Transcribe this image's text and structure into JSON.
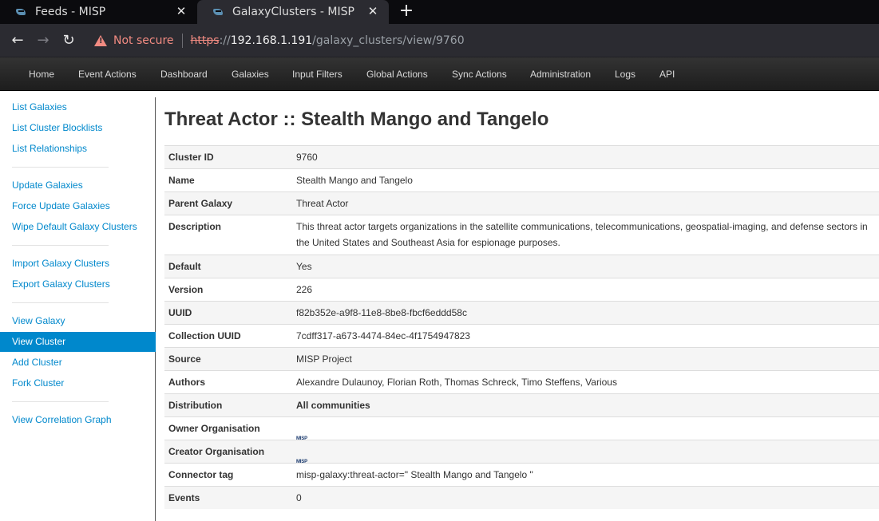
{
  "browser": {
    "tabs": [
      {
        "title": "Feeds - MISP",
        "active": false
      },
      {
        "title": "GalaxyClusters - MISP",
        "active": true
      }
    ],
    "new_tab_icon": "plus-icon",
    "security_label": "Not secure",
    "url": {
      "scheme": "https",
      "sep": "://",
      "host": "192.168.1.191",
      "path": "/galaxy_clusters/view/9760"
    }
  },
  "menu": [
    "Home",
    "Event Actions",
    "Dashboard",
    "Galaxies",
    "Input Filters",
    "Global Actions",
    "Sync Actions",
    "Administration",
    "Logs",
    "API"
  ],
  "sidebar": {
    "groups": [
      [
        "List Galaxies",
        "List Cluster Blocklists",
        "List Relationships"
      ],
      [
        "Update Galaxies",
        "Force Update Galaxies",
        "Wipe Default Galaxy Clusters"
      ],
      [
        "Import Galaxy Clusters",
        "Export Galaxy Clusters"
      ],
      [
        "View Galaxy",
        "View Cluster",
        "Add Cluster",
        "Fork Cluster"
      ],
      [
        "View Correlation Graph"
      ]
    ],
    "active": "View Cluster"
  },
  "page": {
    "title": "Threat Actor :: Stealth Mango and Tangelo"
  },
  "details": [
    {
      "key": "Cluster ID",
      "value": "9760"
    },
    {
      "key": "Name",
      "value": "Stealth Mango and Tangelo"
    },
    {
      "key": "Parent Galaxy",
      "value": "Threat Actor"
    },
    {
      "key": "Description",
      "value": "This threat actor targets organizations in the satellite communications, telecommunications, geospatial-imaging, and defense sectors in the United States and Southeast Asia for espionage purposes."
    },
    {
      "key": "Default",
      "value": "Yes"
    },
    {
      "key": "Version",
      "value": "226"
    },
    {
      "key": "UUID",
      "value": "f82b352e-a9f8-11e8-8be8-fbcf6eddd58c"
    },
    {
      "key": "Collection UUID",
      "value": "7cdff317-a673-4474-84ec-4f1754947823"
    },
    {
      "key": "Source",
      "value": "MISP Project"
    },
    {
      "key": "Authors",
      "value": "Alexandre Dulaunoy, Florian Roth, Thomas Schreck, Timo Steffens, Various"
    },
    {
      "key": "Distribution",
      "value": "All communities"
    },
    {
      "key": "Owner Organisation",
      "logo": "MISP"
    },
    {
      "key": "Creator Organisation",
      "logo": "MISP"
    },
    {
      "key": "Connector tag",
      "value": "misp-galaxy:threat-actor=\" Stealth Mango and Tangelo \""
    },
    {
      "key": "Events",
      "value": "0"
    }
  ],
  "colors": {
    "link": "#0088cc",
    "menu_bg": "#222222",
    "warning": "#f28b82"
  }
}
